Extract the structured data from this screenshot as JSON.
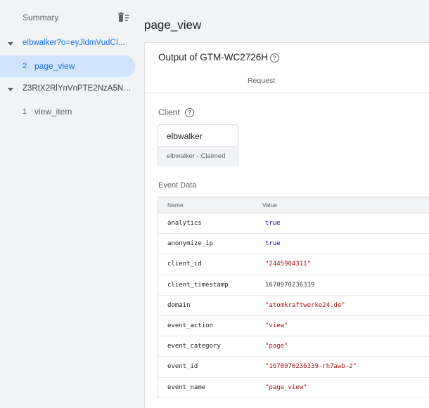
{
  "sidebar": {
    "summary_label": "Summary",
    "containers": [
      {
        "label": "elbwalker?o=eyJldmVudCI...",
        "events": [
          {
            "num": "2",
            "name": "page_view"
          }
        ]
      },
      {
        "label": "Z3RtX2RlYnVnPTE2NzA5Nz...",
        "events": [
          {
            "num": "1",
            "name": "view_item"
          }
        ]
      }
    ]
  },
  "main": {
    "page_title": "page_view",
    "output_title": "Output of GTM-WC2726H",
    "tab_request": "Request",
    "client_label": "Client",
    "client": {
      "name": "elbwalker",
      "status": "elbwalker - Claimed"
    },
    "event_data_label": "Event Data",
    "table": {
      "header_name": "Name",
      "header_value": "Value",
      "rows": [
        {
          "name": "analytics",
          "value": "true"
        },
        {
          "name": "anonymize_ip",
          "value": "true"
        },
        {
          "name": "client_id",
          "value": "\"2445904311\""
        },
        {
          "name": "client_timestamp",
          "value": "1670970236339"
        },
        {
          "name": "domain",
          "value": "\"atomkraftwerke24.de\""
        },
        {
          "name": "event_action",
          "value": "\"view\""
        },
        {
          "name": "event_category",
          "value": "\"page\""
        },
        {
          "name": "event_id",
          "value": "\"1670970236339-rh7awb-2\""
        },
        {
          "name": "event_name",
          "value": "\"page_view\""
        }
      ]
    }
  },
  "colors": {
    "accent": "#1a73e8",
    "selected_bg": "#d2e3fc",
    "string_value": "#a31515",
    "boolean_value": "#1a0dab"
  },
  "icons": {
    "delete": "delete-sweep-icon",
    "help": "help-circle-icon",
    "expand": "caret-down-icon"
  }
}
